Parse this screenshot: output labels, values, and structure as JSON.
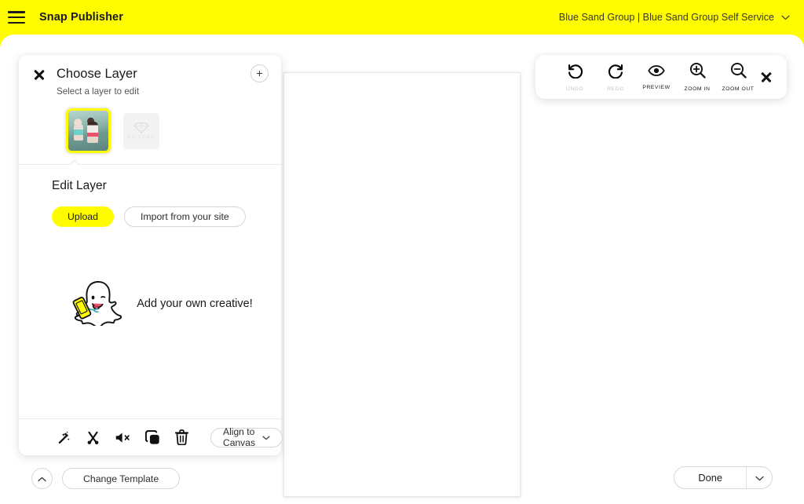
{
  "header": {
    "menu_icon": "hamburger-menu-icon",
    "brand": "Snap Publisher",
    "account": "Blue Sand Group | Blue Sand Group Self Service",
    "account_caret_icon": "chevron-down-icon",
    "background_color": "#FFFC00"
  },
  "panel": {
    "close_icon": "close-icon",
    "title": "Choose Layer",
    "subtitle": "Select a layer to edit",
    "add_button_label": "+",
    "layers": [
      {
        "name": "photo-layer",
        "label": "",
        "selected": true
      },
      {
        "name": "logo-layer",
        "label": "NO LOGO",
        "selected": false
      }
    ],
    "edit": {
      "title": "Edit Layer",
      "upload_label": "Upload",
      "import_label": "Import from your site"
    },
    "empty_state": {
      "mascot_icon": "snapchat-ghost-icon",
      "text": "Add your own creative!"
    },
    "footer": {
      "tools": [
        {
          "name": "magic-wand-icon",
          "label": "Magic Wand"
        },
        {
          "name": "scissors-icon",
          "label": "Trim"
        },
        {
          "name": "mute-speaker-icon",
          "label": "Mute"
        },
        {
          "name": "duplicate-layers-icon",
          "label": "Duplicate"
        },
        {
          "name": "trash-icon",
          "label": "Delete"
        }
      ],
      "align_label": "Align to Canvas",
      "align_caret_icon": "chevron-down-icon"
    }
  },
  "toolbar": {
    "items": [
      {
        "icon": "undo-icon",
        "label": "UNDO",
        "disabled": true
      },
      {
        "icon": "redo-icon",
        "label": "REDO",
        "disabled": true
      },
      {
        "icon": "eye-icon",
        "label": "PREVIEW",
        "disabled": false
      },
      {
        "icon": "zoom-in-icon",
        "label": "ZOOM IN",
        "disabled": false
      },
      {
        "icon": "zoom-out-icon",
        "label": "ZOOM OUT",
        "disabled": false
      }
    ],
    "close_icon": "close-icon"
  },
  "bottom": {
    "collapse_icon": "chevron-up-icon",
    "change_template_label": "Change Template",
    "done_label": "Done",
    "done_caret_icon": "chevron-down-icon"
  },
  "colors": {
    "brand_yellow": "#FFFC00",
    "text_dark": "#1a1a1a",
    "border_grey": "#d6d6d8",
    "disabled_grey": "#c6c6c8"
  }
}
